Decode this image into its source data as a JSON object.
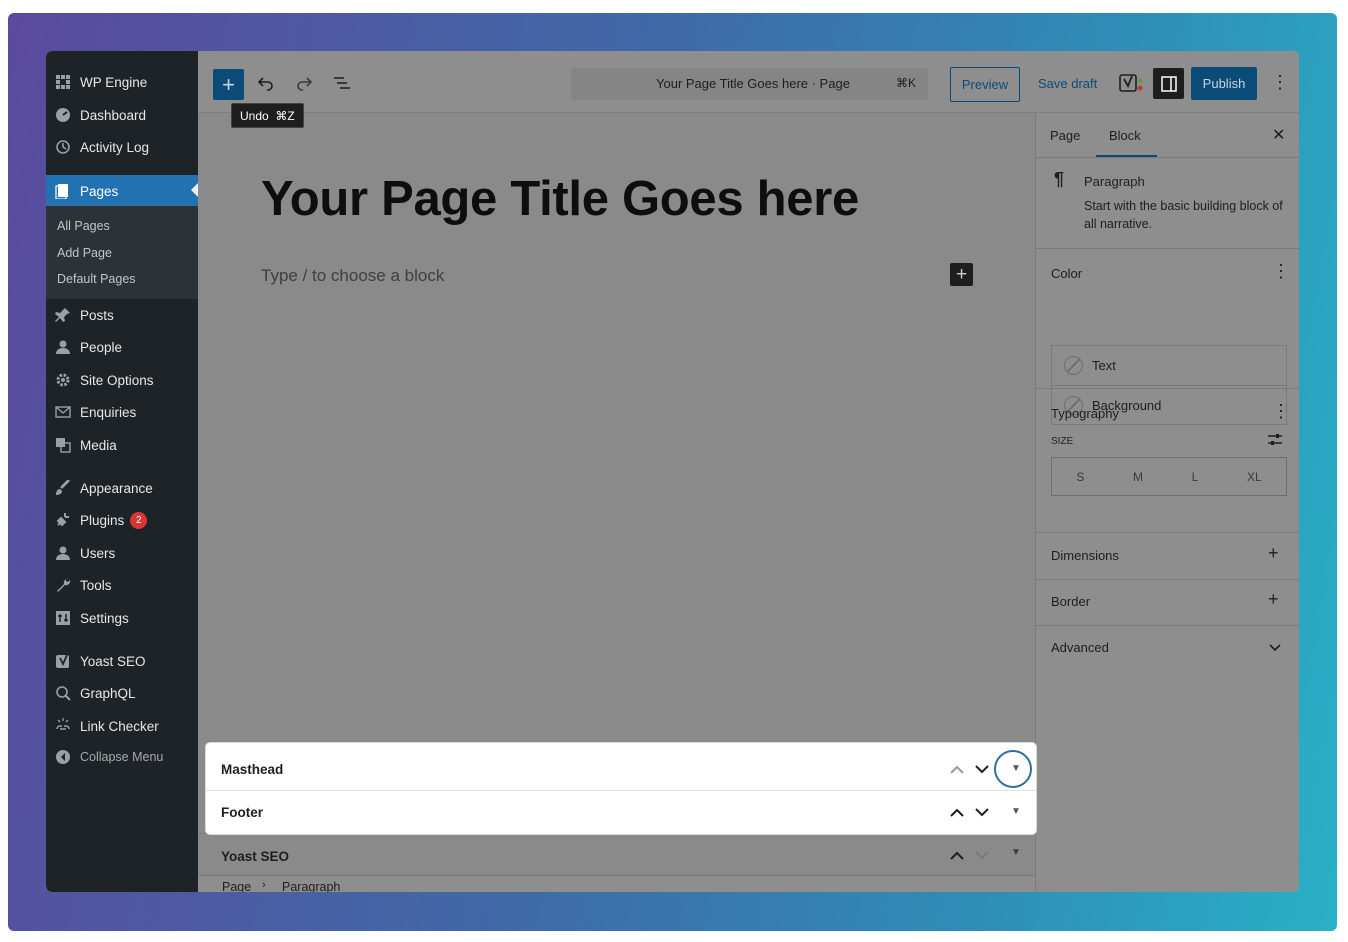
{
  "sidebar": {
    "items": [
      {
        "label": "WP Engine",
        "icon": "wp-engine-icon"
      },
      {
        "label": "Dashboard",
        "icon": "dashboard-icon"
      },
      {
        "label": "Activity Log",
        "icon": "history-icon"
      },
      {
        "label": "Pages",
        "icon": "pages-icon"
      },
      {
        "label": "Posts",
        "icon": "pin-icon"
      },
      {
        "label": "People",
        "icon": "person-icon"
      },
      {
        "label": "Site Options",
        "icon": "gear-icon"
      },
      {
        "label": "Enquiries",
        "icon": "envelope-icon"
      },
      {
        "label": "Media",
        "icon": "media-icon"
      },
      {
        "label": "Appearance",
        "icon": "brush-icon"
      },
      {
        "label": "Plugins",
        "icon": "plug-icon",
        "badge": "2"
      },
      {
        "label": "Users",
        "icon": "users-icon"
      },
      {
        "label": "Tools",
        "icon": "wrench-icon"
      },
      {
        "label": "Settings",
        "icon": "settings-icon"
      },
      {
        "label": "Yoast SEO",
        "icon": "yoast-icon"
      },
      {
        "label": "GraphQL",
        "icon": "graphql-icon"
      },
      {
        "label": "Link Checker",
        "icon": "link-checker-icon"
      },
      {
        "label": "Collapse Menu",
        "icon": "collapse-icon"
      }
    ],
    "submenu": [
      "All Pages",
      "Add Page",
      "Default Pages"
    ]
  },
  "toolbar": {
    "tooltip": "Undo  ⌘Z",
    "command_title": "Your Page Title Goes here · Page",
    "command_shortcut": "⌘K",
    "preview_label": "Preview",
    "save_draft_label": "Save draft",
    "yoast_label": "y",
    "publish_label": "Publish"
  },
  "content": {
    "title": "Your Page Title Goes here",
    "placeholder": "Type / to choose a block"
  },
  "inspector": {
    "tabs": [
      "Page",
      "Block"
    ],
    "active_tab": "Block",
    "block_name": "Paragraph",
    "block_desc": "Start with the basic building block of all narrative.",
    "color_heading": "Color",
    "color_options": [
      "Text",
      "Background"
    ],
    "typography_heading": "Typography",
    "size_label": "SIZE",
    "sizes": [
      "S",
      "M",
      "L",
      "XL"
    ],
    "dimensions_heading": "Dimensions",
    "border_heading": "Border",
    "advanced_heading": "Advanced"
  },
  "meta_boxes": [
    "Masthead",
    "Footer",
    "Yoast SEO"
  ],
  "breadcrumb": [
    "Page",
    "Paragraph"
  ],
  "colors": {
    "accent": "#0a4b78",
    "admin_sidebar": "#1d2327",
    "active_menu": "#2271b1",
    "badge": "#d63638"
  }
}
